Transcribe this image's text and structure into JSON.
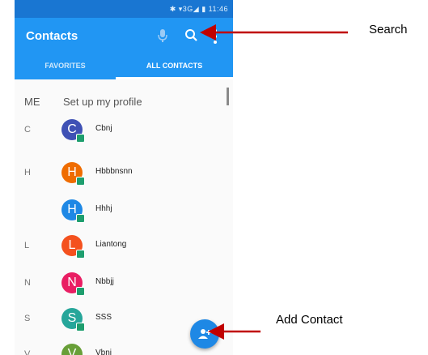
{
  "status_bar": {
    "icons": "✱ ▾3G◢ ▮ 11:46"
  },
  "app_bar": {
    "title": "Contacts"
  },
  "tabs": [
    {
      "label": "FAVORITES",
      "active": false
    },
    {
      "label": "ALL CONTACTS",
      "active": true
    }
  ],
  "profile": {
    "section": "ME",
    "label": "Set up my profile"
  },
  "contacts": [
    {
      "letter": "C",
      "initial": "C",
      "name": "Cbnj",
      "color": "#3f51b5"
    },
    {
      "letter": "H",
      "initial": "H",
      "name": "Hbbbnsnn",
      "color": "#ef6c00"
    },
    {
      "letter": "",
      "initial": "H",
      "name": "Hhhj",
      "color": "#1e88e5"
    },
    {
      "letter": "L",
      "initial": "L",
      "name": "Liantong",
      "color": "#f4511e"
    },
    {
      "letter": "N",
      "initial": "N",
      "name": "Nbbjj",
      "color": "#e91e63"
    },
    {
      "letter": "S",
      "initial": "S",
      "name": "SSS",
      "color": "#26a69a"
    },
    {
      "letter": "V",
      "initial": "V",
      "name": "Vbnj",
      "color": "#689f38"
    }
  ],
  "annotations": {
    "search": "Search",
    "add_contact": "Add Contact"
  },
  "colors": {
    "primary": "#2196f3",
    "status_bar": "#1976d2",
    "arrow": "#c00000",
    "fab": "#1e88e5"
  },
  "icons": [
    "mic-icon",
    "search-icon",
    "more-vert-icon",
    "add-contact-icon"
  ]
}
